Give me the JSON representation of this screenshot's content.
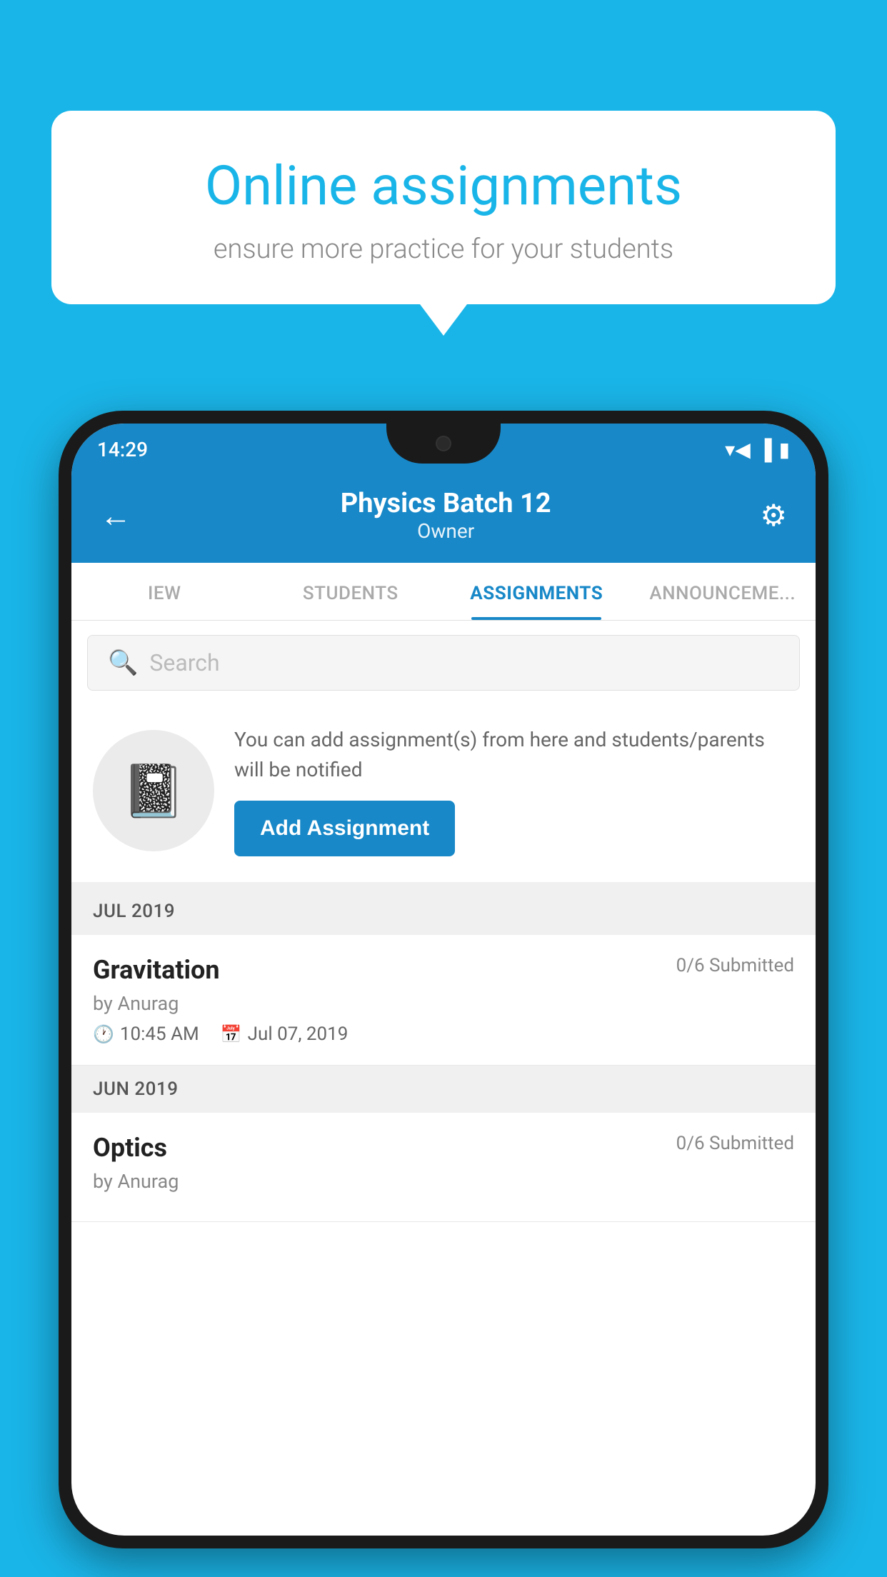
{
  "background_color": "#1ab5e8",
  "speech_bubble": {
    "title": "Online assignments",
    "subtitle": "ensure more practice for your students"
  },
  "phone": {
    "status_bar": {
      "time": "14:29",
      "icons": [
        "wifi",
        "signal",
        "battery"
      ]
    },
    "header": {
      "title": "Physics Batch 12",
      "subtitle": "Owner",
      "back_label": "←",
      "settings_label": "⚙"
    },
    "tabs": [
      {
        "label": "IEW",
        "active": false
      },
      {
        "label": "STUDENTS",
        "active": false
      },
      {
        "label": "ASSIGNMENTS",
        "active": true
      },
      {
        "label": "ANNOUNCEME...",
        "active": false
      }
    ],
    "search": {
      "placeholder": "Search"
    },
    "promo_card": {
      "text": "You can add assignment(s) from here and students/parents will be notified",
      "button_label": "Add Assignment"
    },
    "sections": [
      {
        "label": "JUL 2019",
        "assignments": [
          {
            "name": "Gravitation",
            "status": "0/6 Submitted",
            "author": "by Anurag",
            "time": "10:45 AM",
            "date": "Jul 07, 2019"
          }
        ]
      },
      {
        "label": "JUN 2019",
        "assignments": [
          {
            "name": "Optics",
            "status": "0/6 Submitted",
            "author": "by Anurag",
            "time": "",
            "date": ""
          }
        ]
      }
    ]
  }
}
